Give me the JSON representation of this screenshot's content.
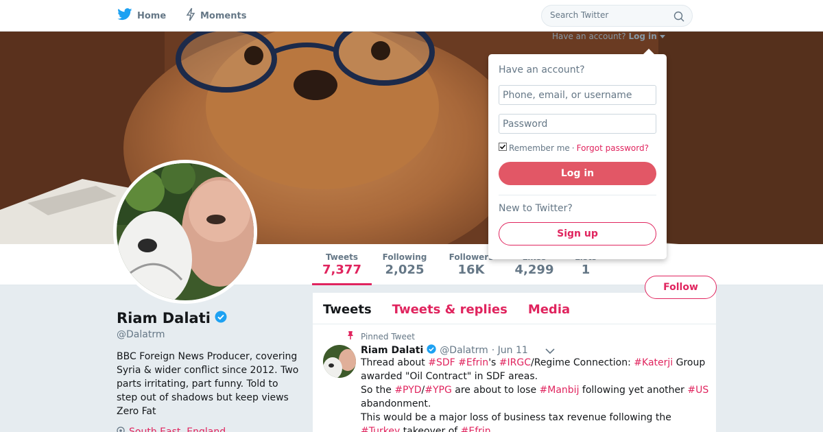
{
  "nav": {
    "home_label": "Home",
    "moments_label": "Moments",
    "search_placeholder": "Search Twitter",
    "account_prompt": "Have an account?",
    "login_link": "Log in"
  },
  "profile_nav": {
    "stats": [
      {
        "label": "Tweets",
        "value": "7,377"
      },
      {
        "label": "Following",
        "value": "2,025"
      },
      {
        "label": "Followers",
        "value": "16K"
      },
      {
        "label": "Likes",
        "value": "4,299"
      },
      {
        "label": "Lists",
        "value": "1"
      }
    ],
    "follow_label": "Follow"
  },
  "profile": {
    "name": "Riam Dalati",
    "handle": "@Dalatrm",
    "bio": "BBC Foreign News Producer, covering Syria & wider conflict since 2012. Two parts irritating, part funny. Told to step out of shadows but keep views Zero Fat",
    "location": "South East, England"
  },
  "timeline": {
    "tabs": [
      "Tweets",
      "Tweets & replies",
      "Media"
    ],
    "pinned_label": "Pinned Tweet",
    "tweet": {
      "name": "Riam Dalati",
      "handle": "@Dalatrm",
      "date": "· Jun 11",
      "lines": [
        [
          {
            "t": "Thread about "
          },
          {
            "t": "#SDF",
            "h": true
          },
          {
            "t": " "
          },
          {
            "t": "#Efrin",
            "h": true
          },
          {
            "t": "'s "
          },
          {
            "t": "#IRGC",
            "h": true
          },
          {
            "t": "/Regime Connection: "
          },
          {
            "t": "#Katerji",
            "h": true
          },
          {
            "t": " Group awarded \"Oil Contract\" in SDF areas."
          }
        ],
        [
          {
            "t": "So the "
          },
          {
            "t": "#PYD",
            "h": true
          },
          {
            "t": "/"
          },
          {
            "t": "#YPG",
            "h": true
          },
          {
            "t": " are about to lose "
          },
          {
            "t": "#Manbij",
            "h": true
          },
          {
            "t": " following yet another "
          },
          {
            "t": "#US",
            "h": true
          },
          {
            "t": " abandonment."
          }
        ],
        [
          {
            "t": "This would be a major loss of business tax revenue following the "
          },
          {
            "t": "#Turkey",
            "h": true
          },
          {
            "t": " takeover of "
          },
          {
            "t": "#Efrin",
            "h": true
          }
        ]
      ]
    }
  },
  "login_dropdown": {
    "title": "Have an account?",
    "phone_placeholder": "Phone, email, or username",
    "password_placeholder": "Password",
    "remember_label": "Remember me",
    "separator": "·",
    "forgot_label": "Forgot password?",
    "login_button": "Log in",
    "new_to_label": "New to Twitter?",
    "signup_button": "Sign up"
  },
  "colors": {
    "accent": "#e0245e",
    "verified": "#1da1f2",
    "login_button": "#e25766"
  },
  "icons": [
    "twitter-bird-icon",
    "bolt-icon",
    "search-icon",
    "caret-down-icon",
    "verified-icon",
    "pin-icon",
    "location-icon",
    "chevron-down-icon"
  ]
}
